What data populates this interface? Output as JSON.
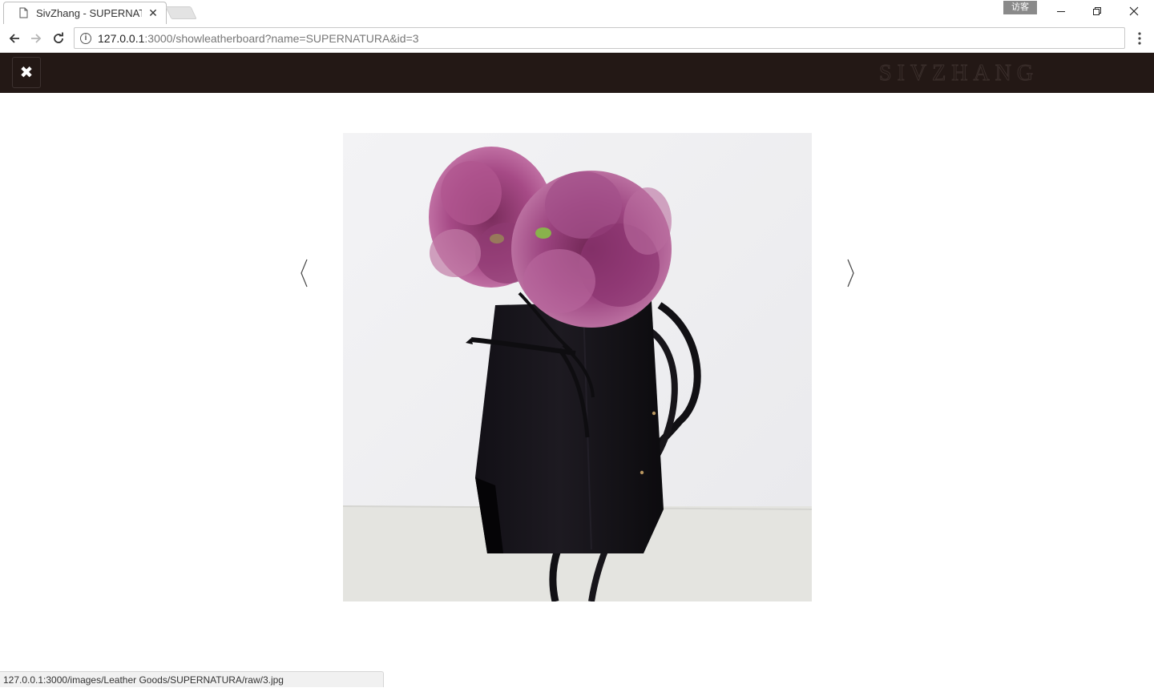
{
  "browser": {
    "tab_title": "SivZhang - SUPERNATU",
    "profile_badge": "访客",
    "url_host": "127.0.0.1",
    "url_rest": ":3000/showleatherboard?name=SUPERNATURA&id=3",
    "status_text": "127.0.0.1:3000/images/Leather Goods/SUPERNATURA/raw/3.jpg"
  },
  "page": {
    "brand": "SIVZHANG",
    "close_glyph": "✖",
    "prev_icon": "chevron-left-icon",
    "next_icon": "chevron-right-icon"
  },
  "colors": {
    "header_bg": "#231815",
    "page_bg": "#ffffff"
  }
}
